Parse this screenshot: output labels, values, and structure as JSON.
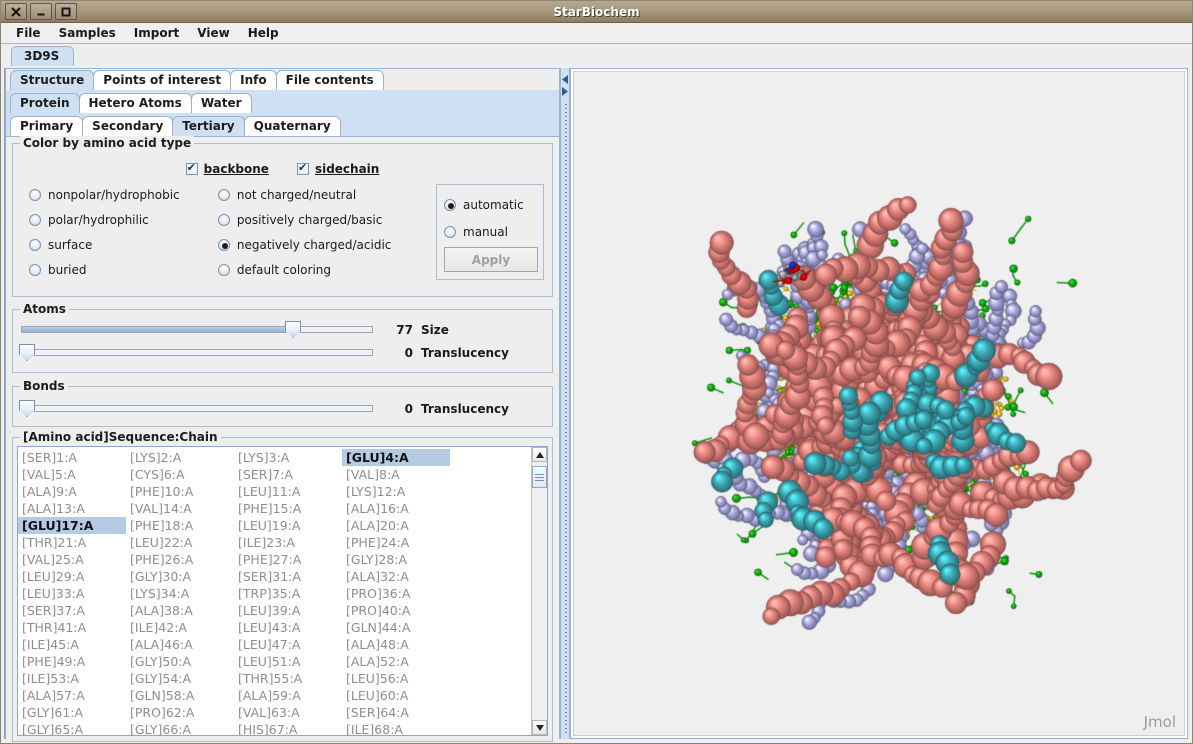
{
  "window": {
    "title": "StarBiochem",
    "controls": [
      {
        "name": "close-button",
        "glyph": "✕"
      },
      {
        "name": "minimize-button",
        "glyph": "▁"
      },
      {
        "name": "maximize-button",
        "glyph": "▫"
      }
    ]
  },
  "menubar": {
    "items": [
      "File",
      "Samples",
      "Import",
      "View",
      "Help"
    ]
  },
  "document_tabs": [
    {
      "label": "3D9S",
      "selected": true
    }
  ],
  "tabs_level1": [
    {
      "label": "Structure",
      "selected": true
    },
    {
      "label": "Points of interest",
      "selected": false
    },
    {
      "label": "Info",
      "selected": false
    },
    {
      "label": "File contents",
      "selected": false
    }
  ],
  "tabs_level2": [
    {
      "label": "Protein",
      "selected": true
    },
    {
      "label": "Hetero Atoms",
      "selected": false
    },
    {
      "label": "Water",
      "selected": false
    }
  ],
  "tabs_level3": [
    {
      "label": "Primary",
      "selected": false
    },
    {
      "label": "Secondary",
      "selected": false
    },
    {
      "label": "Tertiary",
      "selected": true
    },
    {
      "label": "Quaternary",
      "selected": false
    }
  ],
  "color_group": {
    "title": "Color by amino acid type",
    "checkboxes": [
      {
        "label": "backbone",
        "checked": true,
        "mnemonic": "b"
      },
      {
        "label": "sidechain",
        "checked": true,
        "mnemonic": "s"
      }
    ],
    "column1": [
      {
        "label": "nonpolar/hydrophobic",
        "selected": false,
        "mnemonic": "n"
      },
      {
        "label": "polar/hydrophilic",
        "selected": false,
        "mnemonic": "p"
      },
      {
        "label": "surface",
        "selected": false,
        "mnemonic": "f"
      },
      {
        "label": "buried",
        "selected": false,
        "mnemonic": "r"
      }
    ],
    "column2": [
      {
        "label": "not charged/neutral",
        "selected": false,
        "mnemonic": "u"
      },
      {
        "label": "positively charged/basic",
        "selected": false,
        "mnemonic": "o"
      },
      {
        "label": "negatively charged/acidic",
        "selected": true,
        "mnemonic": "e"
      },
      {
        "label": "default coloring",
        "selected": false,
        "mnemonic": "d"
      }
    ],
    "mode": [
      {
        "label": "automatic",
        "selected": true
      },
      {
        "label": "manual",
        "selected": false
      }
    ],
    "apply_label": "Apply",
    "apply_enabled": false
  },
  "atoms_group": {
    "title": "Atoms",
    "sliders": [
      {
        "name": "atom-size-slider",
        "value": 77,
        "max": 100,
        "label": "Size"
      },
      {
        "name": "atom-translucency-slider",
        "value": 0,
        "max": 100,
        "label": "Translucency"
      }
    ]
  },
  "bonds_group": {
    "title": "Bonds",
    "sliders": [
      {
        "name": "bond-translucency-slider",
        "value": 0,
        "max": 100,
        "label": "Translucency"
      }
    ]
  },
  "sequence": {
    "title": "[Amino acid]Sequence:Chain",
    "columns": 4,
    "selected": [
      "[GLU]4:A",
      "[GLU]17:A"
    ],
    "rows": [
      [
        "[SER]1:A",
        "[LYS]2:A",
        "[LYS]3:A",
        "[GLU]4:A"
      ],
      [
        "[VAL]5:A",
        "[CYS]6:A",
        "[SER]7:A",
        "[VAL]8:A"
      ],
      [
        "[ALA]9:A",
        "[PHE]10:A",
        "[LEU]11:A",
        "[LYS]12:A"
      ],
      [
        "[ALA]13:A",
        "[VAL]14:A",
        "[PHE]15:A",
        "[ALA]16:A"
      ],
      [
        "[GLU]17:A",
        "[PHE]18:A",
        "[LEU]19:A",
        "[ALA]20:A"
      ],
      [
        "[THR]21:A",
        "[LEU]22:A",
        "[ILE]23:A",
        "[PHE]24:A"
      ],
      [
        "[VAL]25:A",
        "[PHE]26:A",
        "[PHE]27:A",
        "[GLY]28:A"
      ],
      [
        "[LEU]29:A",
        "[GLY]30:A",
        "[SER]31:A",
        "[ALA]32:A"
      ],
      [
        "[LEU]33:A",
        "[LYS]34:A",
        "[TRP]35:A",
        "[PRO]36:A"
      ],
      [
        "[SER]37:A",
        "[ALA]38:A",
        "[LEU]39:A",
        "[PRO]40:A"
      ],
      [
        "[THR]41:A",
        "[ILE]42:A",
        "[LEU]43:A",
        "[GLN]44:A"
      ],
      [
        "[ILE]45:A",
        "[ALA]46:A",
        "[LEU]47:A",
        "[ALA]48:A"
      ],
      [
        "[PHE]49:A",
        "[GLY]50:A",
        "[LEU]51:A",
        "[ALA]52:A"
      ],
      [
        "[ILE]53:A",
        "[GLY]54:A",
        "[THR]55:A",
        "[LEU]56:A"
      ],
      [
        "[ALA]57:A",
        "[GLN]58:A",
        "[ALA]59:A",
        "[LEU]60:A"
      ],
      [
        "[GLY]61:A",
        "[PRO]62:A",
        "[VAL]63:A",
        "[SER]64:A"
      ],
      [
        "[GLY]65:A",
        "[GLY]66:A",
        "[HIS]67:A",
        "[ILE]68:A"
      ]
    ]
  },
  "viewer": {
    "watermark": "Jmol",
    "background": "#efefef",
    "atom_colors": {
      "acidic_red": "#e8847e",
      "basic_purple": "#a9a8e0",
      "teal": "#3fa8b4",
      "neutral_yellow": "#f0c020",
      "green": "#14b014",
      "oxygen_red": "#e00000",
      "nitrogen_blue": "#1030d0",
      "carbon_grey": "#a0a0a0"
    }
  }
}
